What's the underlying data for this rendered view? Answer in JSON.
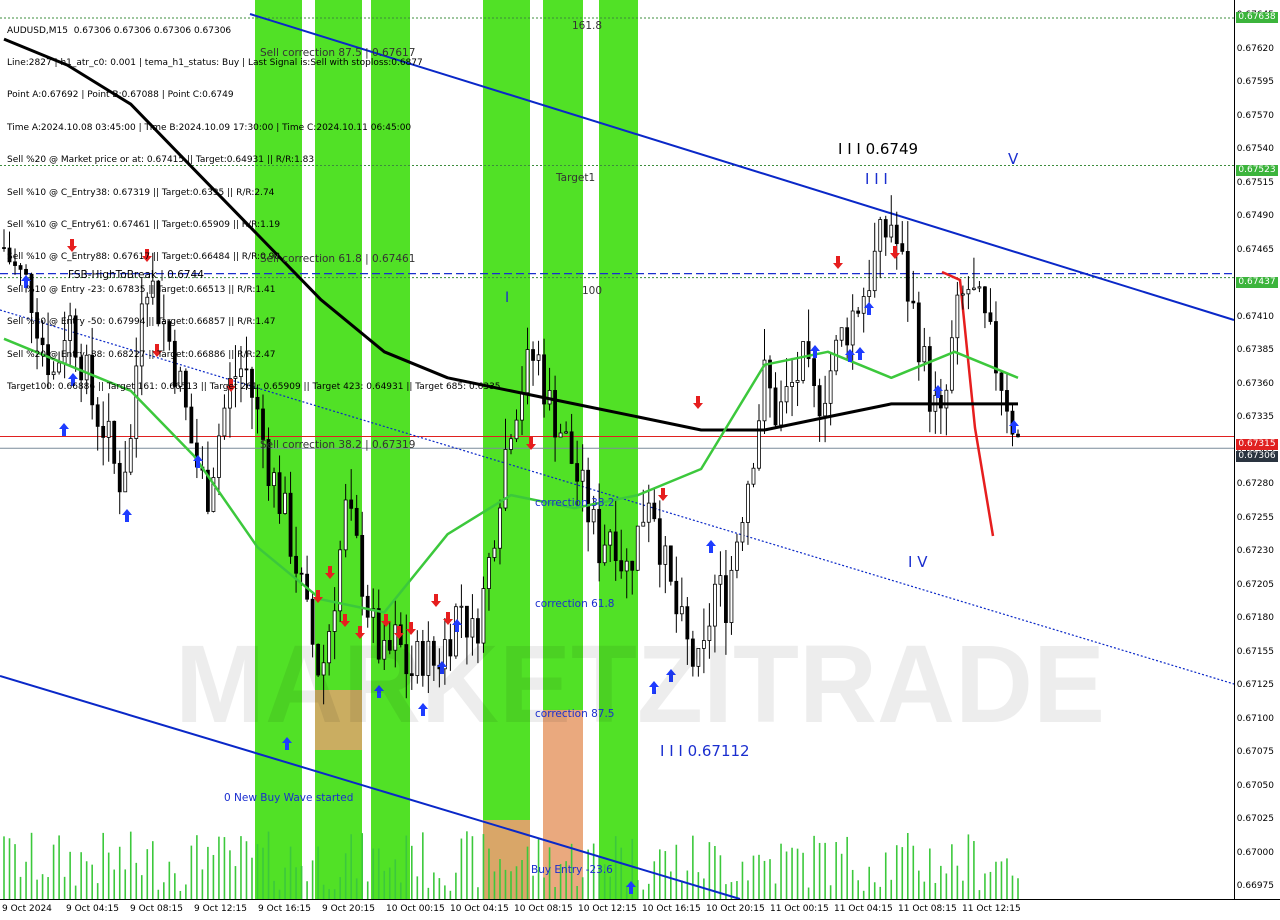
{
  "header": {
    "lines": [
      "AUDUSD,M15  0.67306 0.67306 0.67306 0.67306",
      "Line:2827 | h1_atr_c0: 0.001 | tema_h1_status: Buy | Last Signal is:Sell with stoploss:0.6877",
      "Point A:0.67692 | Point B:0.67088 | Point C:0.6749",
      "Time A:2024.10.08 03:45:00 | Time B:2024.10.09 17:30:00 | Time C:2024.10.11 06:45:00",
      "Sell %20 @ Market price or at: 0.67415 || Target:0.64931 || R/R:1.83",
      "Sell %10 @ C_Entry38: 0.67319 || Target:0.6335 || R/R:2.74",
      "Sell %10 @ C_Entry61: 0.67461 || Target:0.65909 || R/R:1.19",
      "Sell %10 @ C_Entry88: 0.67617 || Target:0.66484 || R/R:0.98",
      "Sell %10 @ Entry -23: 0.67835 || Target:0.66513 || R/R:1.41",
      "Sell %20 @ Entry -50: 0.67994 || Target:0.66857 || R/R:1.47",
      "Sell %20 @ Entry -88: 0.68227 || Target:0.66886 || R/R:2.47",
      "Target100: 0.66886 || Target 161: 0.66513 || Target 261: 0.65909 || Target 423: 0.64931 || Target 685: 0.6335"
    ]
  },
  "annotations": {
    "sell_correction_87": "Sell correction 87.5 | 0.67617",
    "sell_correction_61": "Sell correction 61.8 | 0.67461",
    "sell_correction_38": "Sell correction 38.2 | 0.67319",
    "feb_high": "FSB-HighToBreak | 0.6744",
    "fib_161": "161.8",
    "fib_100": "100",
    "target1": "Target1",
    "wave_III_top": "I I I 0.6749",
    "wave_III_bot": "I I I 0.67112",
    "wave_I": "I",
    "wave_III_small": "I I I",
    "wave_IV": "I V",
    "wave_V": "V",
    "correction_38": "correction 38.2",
    "correction_61": "correction 61.8",
    "correction_87": "correction 87.5",
    "new_buy_wave": "0 New Buy Wave started",
    "buy_entry": "Buy Entry -23.6",
    "watermark": "MARKETZITRADE"
  },
  "price_tags": {
    "top": "0.67638",
    "target_line": "0.67523",
    "fsb_line": "0.67437",
    "red_line": "0.67315",
    "current": "0.67306"
  },
  "colors": {
    "background": "#ffffff",
    "candle": "#000000",
    "ma_slow": "#000000",
    "ma_fast": "#3cc83c",
    "channel": "#0a28c8",
    "green_zone": "#32dc00",
    "orange_zone": "#e8a070",
    "sell_arrow": "#e61e1e",
    "buy_arrow": "#1e3cff",
    "red_line": "#e02020",
    "current_line": "#7a8c9a",
    "volume": "#3cc83c"
  },
  "chart_data": {
    "type": "candlestick",
    "symbol": "AUDUSD",
    "timeframe": "M15",
    "ylim": [
      0.6696,
      0.6765
    ],
    "y_ticks": [
      "0.67645",
      "0.67620",
      "0.67595",
      "0.67570",
      "0.67540",
      "0.67515",
      "0.67490",
      "0.67465",
      "0.67435",
      "0.67410",
      "0.67385",
      "0.67360",
      "0.67335",
      "0.67305",
      "0.67280",
      "0.67255",
      "0.67230",
      "0.67205",
      "0.67180",
      "0.67155",
      "0.67125",
      "0.67100",
      "0.67075",
      "0.67050",
      "0.67025",
      "0.67000",
      "0.66975"
    ],
    "x_ticks": [
      "9 Oct 2024",
      "9 Oct 04:15",
      "9 Oct 08:15",
      "9 Oct 12:15",
      "9 Oct 16:15",
      "9 Oct 20:15",
      "10 Oct 00:15",
      "10 Oct 04:15",
      "10 Oct 08:15",
      "10 Oct 12:15",
      "10 Oct 16:15",
      "10 Oct 20:15",
      "11 Oct 00:15",
      "11 Oct 04:15",
      "11 Oct 08:15",
      "11 Oct 12:15"
    ],
    "levels": {
      "point_a": 0.67692,
      "point_b": 0.67088,
      "point_c": 0.6749,
      "target_line": 0.67523,
      "fsb_high": 0.6744,
      "red_line": 0.67315,
      "current": 0.67306
    },
    "close_path": [
      0.6746,
      0.6744,
      0.6743,
      0.6739,
      0.6736,
      0.6741,
      0.6738,
      0.6734,
      0.6732,
      0.6728,
      0.6731,
      0.6745,
      0.6742,
      0.6739,
      0.6735,
      0.673,
      0.6727,
      0.6732,
      0.6736,
      0.6737,
      0.6733,
      0.6729,
      0.6726,
      0.6722,
      0.6717,
      0.6713,
      0.6719,
      0.6726,
      0.6722,
      0.6717,
      0.6714,
      0.6716,
      0.6713,
      0.6715,
      0.6714,
      0.6716,
      0.6719,
      0.6716,
      0.672,
      0.6727,
      0.6733,
      0.6736,
      0.6738,
      0.6734,
      0.6732,
      0.6729,
      0.6726,
      0.6723,
      0.6725,
      0.6721,
      0.6724,
      0.6728,
      0.6722,
      0.6718,
      0.6715,
      0.6713,
      0.672,
      0.6719,
      0.6725,
      0.673,
      0.6736,
      0.6733,
      0.6735,
      0.6737,
      0.6734,
      0.6736,
      0.6739,
      0.6741,
      0.6743,
      0.6746,
      0.6748,
      0.6744,
      0.674,
      0.6735,
      0.6732,
      0.674,
      0.6743,
      0.6741,
      0.6738,
      0.6735,
      0.6731
    ],
    "ma_slow": [
      0.6762,
      0.676,
      0.6757,
      0.6752,
      0.6747,
      0.6742,
      0.6738,
      0.6736,
      0.6735,
      0.6734,
      0.6733,
      0.6732,
      0.6732,
      0.6733,
      0.6734,
      0.6734,
      0.6734
    ],
    "ma_fast": [
      0.6739,
      0.6737,
      0.6735,
      0.673,
      0.6723,
      0.6719,
      0.6718,
      0.6724,
      0.6727,
      0.6726,
      0.6727,
      0.6729,
      0.6737,
      0.6738,
      0.6736,
      0.6738,
      0.6736
    ]
  }
}
